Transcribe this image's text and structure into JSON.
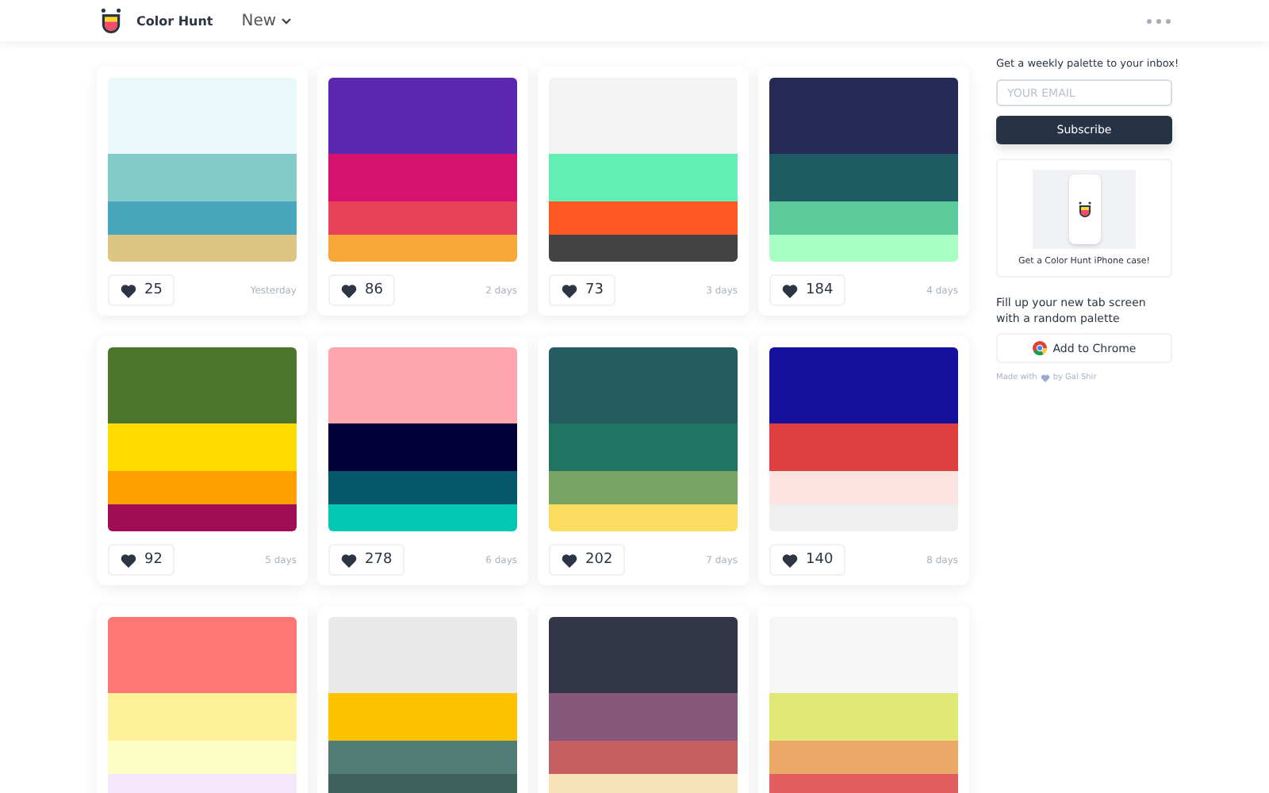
{
  "header": {
    "brand": "Color Hunt",
    "menu": "New"
  },
  "palettes": [
    {
      "colors": [
        {
          "color": "#eaf9f9"
        },
        {
          "color": "#82cbc8"
        },
        {
          "color": "#4aa7bb"
        },
        {
          "color": "#dbc682"
        }
      ],
      "likes": "25",
      "age": "Yesterday"
    },
    {
      "colors": [
        {
          "color": "#5b27b0"
        },
        {
          "color": "#d6126f"
        },
        {
          "color": "#e6435a"
        },
        {
          "color": "#f8a838"
        }
      ],
      "likes": "86",
      "age": "2 days"
    },
    {
      "colors": [
        {
          "color": "#f3f3f3"
        },
        {
          "color": "#62f0b7"
        },
        {
          "color": "#fe5722"
        },
        {
          "color": "#424242"
        }
      ],
      "likes": "73",
      "age": "3 days"
    },
    {
      "colors": [
        {
          "color": "#252a54"
        },
        {
          "color": "#1f5b62"
        },
        {
          "color": "#5cca9a"
        },
        {
          "color": "#a8ffc3"
        }
      ],
      "likes": "184",
      "age": "4 days"
    },
    {
      "colors": [
        {
          "color": "#4b762c"
        },
        {
          "color": "#ffdb00"
        },
        {
          "color": "#fea000"
        },
        {
          "color": "#a00c55"
        }
      ],
      "likes": "92",
      "age": "5 days"
    },
    {
      "colors": [
        {
          "color": "#fea5ad"
        },
        {
          "color": "#020039"
        },
        {
          "color": "#05576a"
        },
        {
          "color": "#04c9b2"
        }
      ],
      "likes": "278",
      "age": "6 days"
    },
    {
      "colors": [
        {
          "color": "#255c61"
        },
        {
          "color": "#1f7462"
        },
        {
          "color": "#78a564"
        },
        {
          "color": "#fbdc5e"
        }
      ],
      "likes": "202",
      "age": "7 days"
    },
    {
      "colors": [
        {
          "color": "#14119c"
        },
        {
          "color": "#de4040"
        },
        {
          "color": "#fde3e1"
        },
        {
          "color": "#efefef"
        }
      ],
      "likes": "140",
      "age": "8 days"
    },
    {
      "colors": [
        {
          "color": "#ff7774"
        },
        {
          "color": "#fef199"
        },
        {
          "color": "#fbfec4"
        },
        {
          "color": "#f5e8fb"
        }
      ]
    },
    {
      "colors": [
        {
          "color": "#e9e9e9"
        },
        {
          "color": "#fec300"
        },
        {
          "color": "#527d76"
        },
        {
          "color": "#3f615b"
        }
      ]
    },
    {
      "colors": [
        {
          "color": "#323646"
        },
        {
          "color": "#86587b"
        },
        {
          "color": "#c55f61"
        },
        {
          "color": "#f7e2b8"
        }
      ]
    },
    {
      "colors": [
        {
          "color": "#f6f6f6"
        },
        {
          "color": "#e0e975"
        },
        {
          "color": "#eba866"
        },
        {
          "color": "#e25f5f"
        }
      ]
    }
  ],
  "sidebar": {
    "newsletter": "Get a weekly palette to your inbox!",
    "email_placeholder": "YOUR EMAIL",
    "subscribe": "Subscribe",
    "case_caption": "Get a Color Hunt iPhone case!",
    "tab_text": "Fill up your new tab screen with a random palette",
    "chrome_button": "Add to Chrome",
    "made_with": "Made with",
    "by": "by Gal Shir"
  }
}
